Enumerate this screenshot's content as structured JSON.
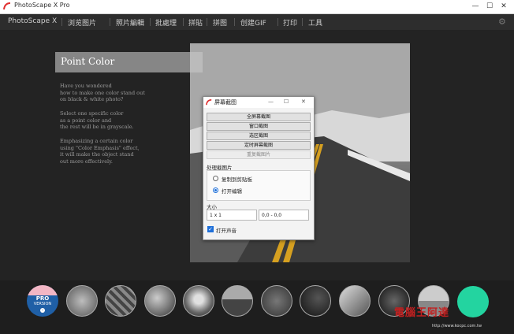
{
  "window": {
    "title": "PhotoScape X Pro"
  },
  "menu": {
    "items": [
      "PhotoScape X",
      "浏览图片",
      "照片編輯",
      "批處理",
      "拼貼",
      "拼图",
      "创建GIF",
      "打印",
      "工具"
    ]
  },
  "panel": {
    "title": "Point Color",
    "paragraphs": [
      [
        "Have you wondered",
        "how to make one color stand out",
        "on black & white photo?"
      ],
      [
        "Select one specific color",
        "as a point color and",
        "the rest will be in grayscale."
      ],
      [
        "Emphasizing a certain color",
        "using  \"Color Emphasis\"  effect,",
        "it will make the object stand",
        "out more effectively."
      ]
    ]
  },
  "dialog": {
    "title": "屏幕截图",
    "controls": {
      "minimize": "—",
      "maximize": "☐",
      "close": "✕"
    },
    "buttons": [
      "全屏幕截图",
      "窗口截图",
      "选区截图",
      "定时屏幕截图",
      "重复截图片"
    ],
    "section_label": "处理截图片",
    "options": [
      {
        "label": "复制到剪贴板",
        "selected": false
      },
      {
        "label": "打开编辑",
        "selected": true
      }
    ],
    "size_label": "大小",
    "size_value": "1 x 1",
    "coord_value": "0,0 - 0,0",
    "checkbox": {
      "label": "打开声音",
      "checked": true
    }
  },
  "pro_badge": {
    "line1": "PRO",
    "line2": "VERSION",
    "arrow": "›"
  },
  "watermark": {
    "text": "電腦王阿達",
    "url": "http://www.kocpc.com.tw"
  },
  "colors": {
    "accent": "#1e6fd9",
    "teal": "#23d4a0",
    "pro_blue": "#1f5fa6",
    "pro_pink": "#f2b6c4"
  }
}
